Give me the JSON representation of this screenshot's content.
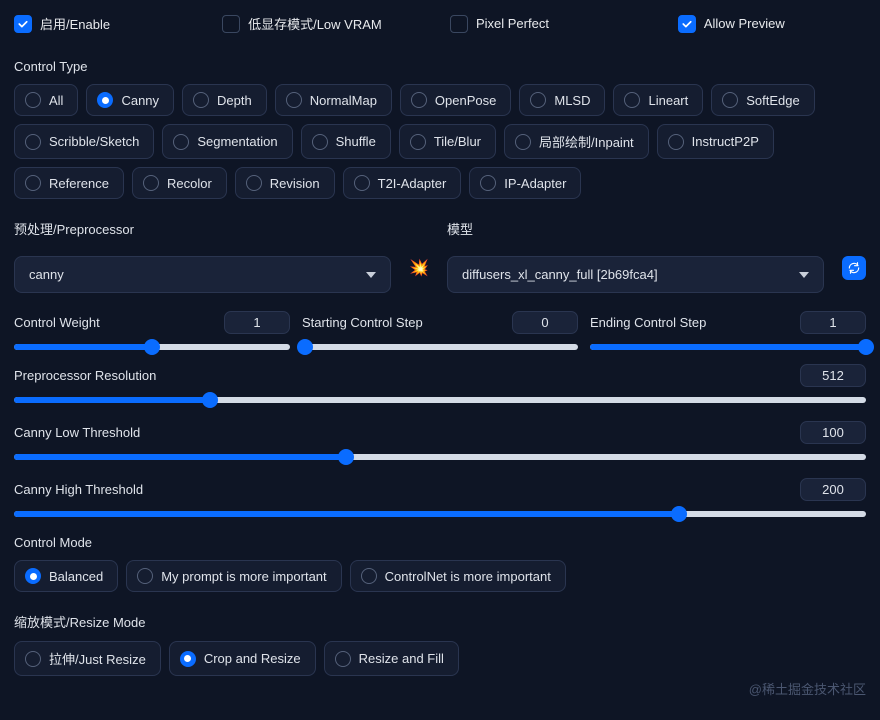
{
  "checkboxes": {
    "enable": {
      "label": "启用/Enable",
      "checked": true
    },
    "low_vram": {
      "label": "低显存模式/Low VRAM",
      "checked": false
    },
    "pixel_perfect": {
      "label": "Pixel Perfect",
      "checked": false
    },
    "allow_preview": {
      "label": "Allow Preview",
      "checked": true
    }
  },
  "control_type": {
    "label": "Control Type",
    "selected": "Canny",
    "options": [
      "All",
      "Canny",
      "Depth",
      "NormalMap",
      "OpenPose",
      "MLSD",
      "Lineart",
      "SoftEdge",
      "Scribble/Sketch",
      "Segmentation",
      "Shuffle",
      "Tile/Blur",
      "局部绘制/Inpaint",
      "InstructP2P",
      "Reference",
      "Recolor",
      "Revision",
      "T2I-Adapter",
      "IP-Adapter"
    ]
  },
  "preprocessor": {
    "label": "预处理/Preprocessor",
    "value": "canny"
  },
  "model": {
    "label": "模型",
    "value": "diffusers_xl_canny_full [2b69fca4]"
  },
  "sliders_trio": {
    "control_weight": {
      "label": "Control Weight",
      "value": "1",
      "pct": 50
    },
    "starting_step": {
      "label": "Starting Control Step",
      "value": "0",
      "pct": 1
    },
    "ending_step": {
      "label": "Ending Control Step",
      "value": "1",
      "pct": 100
    }
  },
  "sliders_full": {
    "preproc_res": {
      "label": "Preprocessor Resolution",
      "value": "512",
      "pct": 23
    },
    "canny_low": {
      "label": "Canny Low Threshold",
      "value": "100",
      "pct": 39
    },
    "canny_high": {
      "label": "Canny High Threshold",
      "value": "200",
      "pct": 78
    }
  },
  "control_mode": {
    "label": "Control Mode",
    "selected": "Balanced",
    "options": [
      "Balanced",
      "My prompt is more important",
      "ControlNet is more important"
    ]
  },
  "resize_mode": {
    "label": "缩放模式/Resize Mode",
    "selected": "Crop and Resize",
    "options": [
      "拉伸/Just Resize",
      "Crop and Resize",
      "Resize and Fill"
    ]
  },
  "watermark": "@稀土掘金技术社区"
}
